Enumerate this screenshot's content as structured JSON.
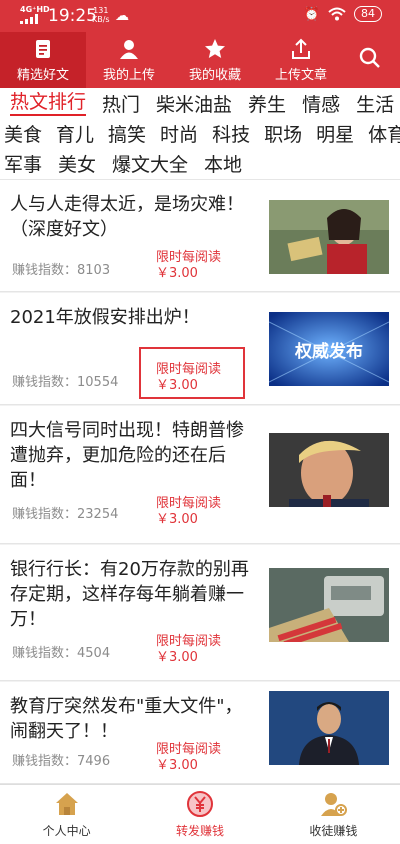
{
  "status_bar": {
    "signal": "4G⁺HD",
    "time": "19:25",
    "net_speed_value": "131",
    "net_speed_unit": "KB/s",
    "battery": "84",
    "icons": [
      "signal-icon",
      "cloud-icon",
      "alarm-icon",
      "wifi-icon",
      "battery-icon"
    ]
  },
  "top_nav": {
    "tabs": [
      {
        "label": "精选好文",
        "icon": "document-icon",
        "active": true
      },
      {
        "label": "我的上传",
        "icon": "person-icon",
        "active": false
      },
      {
        "label": "我的收藏",
        "icon": "star-icon",
        "active": false
      },
      {
        "label": "上传文章",
        "icon": "upload-icon",
        "active": false
      }
    ],
    "search_icon": "search-icon"
  },
  "categories": {
    "row1": [
      "热文排行",
      "热门",
      "柴米油盐",
      "养生",
      "情感",
      "生活"
    ],
    "row2": [
      "美食",
      "育儿",
      "搞笑",
      "时尚",
      "科技",
      "职场",
      "明星",
      "体育"
    ],
    "row3": [
      "军事",
      "美女",
      "爆文大全",
      "本地"
    ],
    "active": "热文排行"
  },
  "articles": [
    {
      "title": "人与人走得太近，是场灾难！（深度好文）",
      "score_label": "赚钱指数：8103",
      "promo": "限时每阅读",
      "price": "￥3.00",
      "image": "woman-in-red-photo"
    },
    {
      "title": "2021年放假安排出炉！",
      "score_label": "赚钱指数：10554",
      "promo": "限时每阅读",
      "price": "￥3.00",
      "image": "authority-release-banner",
      "image_text": "权威发布",
      "highlighted": true
    },
    {
      "title": "四大信号同时出现！特朗普惨遭抛弃，更加危险的还在后面！",
      "score_label": "赚钱指数：23254",
      "promo": "限时每阅读",
      "price": "￥3.00",
      "image": "politician-portrait-photo"
    },
    {
      "title": "银行行长：有20万存款的别再存定期，这样存每年躺着赚一万！",
      "score_label": "赚钱指数：4504",
      "promo": "限时每阅读",
      "price": "￥3.00",
      "image": "cash-counting-machine-photo"
    },
    {
      "title": "教育厅突然发布\"重大文件\"，闹翻天了！！",
      "score_label": "赚钱指数：7496",
      "promo": "限时每阅读",
      "price": "￥3.00",
      "image": "news-anchor-photo"
    }
  ],
  "bottom_nav": [
    {
      "label": "个人中心",
      "icon": "home-icon",
      "active": false
    },
    {
      "label": "转发赚钱",
      "icon": "yuan-coin-icon",
      "active": true
    },
    {
      "label": "收徒赚钱",
      "icon": "user-add-icon",
      "active": false
    }
  ],
  "colors": {
    "brand_red": "#d8343b",
    "price_red": "#e0343a",
    "text": "#222222",
    "muted": "#8c8c8c"
  }
}
